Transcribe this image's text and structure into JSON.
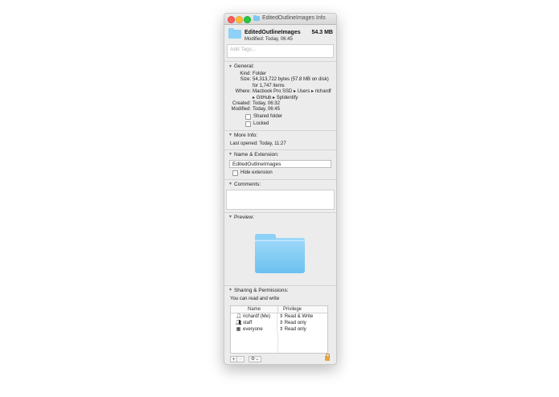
{
  "window": {
    "title": "EditedOutlineImages Info"
  },
  "header": {
    "name": "EditedOutlineImages",
    "size": "54.3 MB",
    "modified": "Modified: Today, 06:45"
  },
  "tags": {
    "placeholder": "Add Tags..."
  },
  "general": {
    "heading": "General:",
    "rows": [
      {
        "key": "Kind:",
        "value": "Folder"
      },
      {
        "key": "Size:",
        "value": "54,313,722 bytes (57.8 MB on disk) for 1,747 items"
      },
      {
        "key": "Where:",
        "value": "Macbook Pro SSD ▸ Users ▸ richardf ▸ GitHub ▸ SpIdentify"
      },
      {
        "key": "Created:",
        "value": "Today, 06:32"
      },
      {
        "key": "Modified:",
        "value": "Today, 06:45"
      }
    ],
    "shared_label": "Shared folder",
    "locked_label": "Locked"
  },
  "more_info": {
    "heading": "More Info:",
    "last_opened": "Last opened: Today, 11:27"
  },
  "name_ext": {
    "heading": "Name & Extension:",
    "value": "EditedOutlineImages",
    "hide_label": "Hide extension"
  },
  "comments": {
    "heading": "Comments:"
  },
  "preview": {
    "heading": "Preview:"
  },
  "sharing": {
    "heading": "Sharing & Permissions:",
    "summary": "You can read and write",
    "col_name": "Name",
    "col_privilege": "Privilege",
    "rows": [
      {
        "name": "richardf (Me)",
        "privilege": "Read & Write",
        "icon": "user-icon"
      },
      {
        "name": "staff",
        "privilege": "Read only",
        "icon": "group-icon"
      },
      {
        "name": "everyone",
        "privilege": "Read only",
        "icon": "everyone-icon"
      }
    ],
    "add": "+",
    "remove": "−",
    "gear": "⚙︎⌄"
  }
}
